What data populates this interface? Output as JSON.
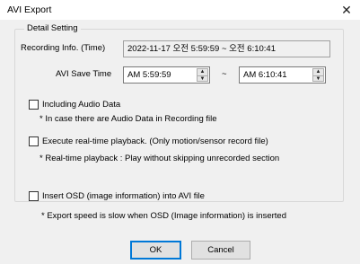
{
  "window": {
    "title": "AVI Export",
    "close_glyph": "✕"
  },
  "group": {
    "title": "Detail Setting"
  },
  "recording_info": {
    "label": "Recording Info. (Time)",
    "value": "2022-11-17 오전 5:59:59 ~ 오전 6:10:41"
  },
  "save_time": {
    "label": "AVI Save Time",
    "start": "AM  5:59:59",
    "separator": "~",
    "end": "AM  6:10:41"
  },
  "options": {
    "audio": {
      "label": "Including Audio Data",
      "note": "* In case there are Audio Data in Recording file",
      "checked": false
    },
    "realtime": {
      "label": "Execute real-time playback. (Only motion/sensor record file)",
      "note": "* Real-time playback : Play without skipping unrecorded section",
      "checked": false
    },
    "osd": {
      "label": "Insert OSD (image information) into AVI file",
      "note": "* Export speed is slow when OSD (Image information) is inserted",
      "checked": false
    }
  },
  "buttons": {
    "ok": "OK",
    "cancel": "Cancel"
  }
}
